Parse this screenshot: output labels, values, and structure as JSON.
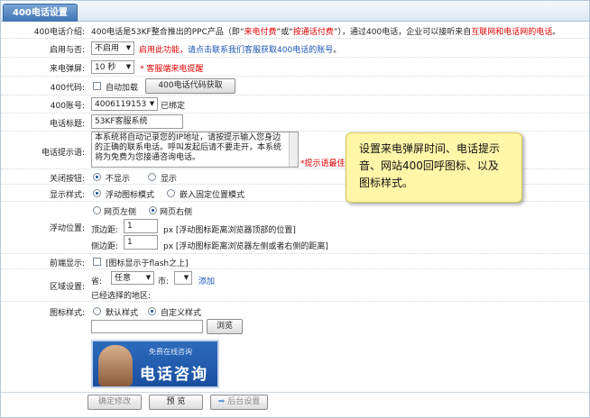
{
  "tab": {
    "label": "400电话设置"
  },
  "intro": {
    "label": "400电话介绍:",
    "text_a": "400电话是53KF整合推出的PPC产品（即“",
    "red_a": "来电付费",
    "text_b": "”或“",
    "red_b": "按通话付费",
    "text_c": "”），通过400电话，企业可以接听来自",
    "red_c": "互联网和电话网的电话",
    "text_d": "。"
  },
  "enable": {
    "label": "启用与否:",
    "selected": "不启用",
    "note_red": "启用此功能，",
    "link": "请点击联系我们客服获取400电话的账号",
    "note_end": "。"
  },
  "popup": {
    "label": "来电弹屏:",
    "selected": "10 秒",
    "note": "* 客服端来电提醒"
  },
  "code": {
    "label": "400代码:",
    "checkbox_label": "自动加载",
    "button": "400电话代码获取"
  },
  "account": {
    "label": "400账号:",
    "selected": "4006119153",
    "note": "已绑定"
  },
  "title": {
    "label": "电话标题:",
    "value": "53KF客服系统"
  },
  "prompt": {
    "label": "电话提示语:",
    "value": "本系统将自动记录您的IP地址，请按提示输入您身边的正确的联系电话。呼叫发起后请不要走开，本系统将为免费为您接通咨询电话。",
    "note": "*提示语最佳字"
  },
  "close": {
    "label": "关闭按钮:",
    "opt1": "不显示",
    "opt2": "显示"
  },
  "display": {
    "label": "显示样式:",
    "opt1": "浮动图标模式",
    "opt2": "嵌入固定位置模式"
  },
  "float": {
    "label": "浮动位置:",
    "opt1": "网页左侧",
    "opt2": "网页右侧",
    "top_label": "顶边距:",
    "top_value": "1",
    "top_unit": "px [浮动图标距离浏览器顶部的位置]",
    "side_label": "侧边距:",
    "side_value": "1",
    "side_unit": "px [浮动图标距离浏览器左侧或者右侧的距离]"
  },
  "front": {
    "label": "前端显示:",
    "checkbox_label": "[图标显示于flash之上]"
  },
  "region": {
    "label": "区域设置:",
    "province_label": "省:",
    "province_value": "任意",
    "city_label": "市:",
    "add": "添加",
    "selected_label": "已经选择的地区:"
  },
  "iconstyle": {
    "label": "图标样式:",
    "opt1": "默认样式",
    "opt2": "自定义样式",
    "browse": "浏览"
  },
  "banner": {
    "small": "免费在线咨询",
    "big": "电话咨询"
  },
  "footer": {
    "confirm": "确定修改",
    "preview": "预 览",
    "backend": "后台设置"
  },
  "callout": {
    "text": "设置来电弹屏时间、电话提示音、网站400回呼图标、以及图标样式。"
  },
  "colors": {
    "accent": "#3f73b5",
    "red": "#e00000",
    "link": "#1a55b4",
    "callout": "#fff6a8"
  }
}
